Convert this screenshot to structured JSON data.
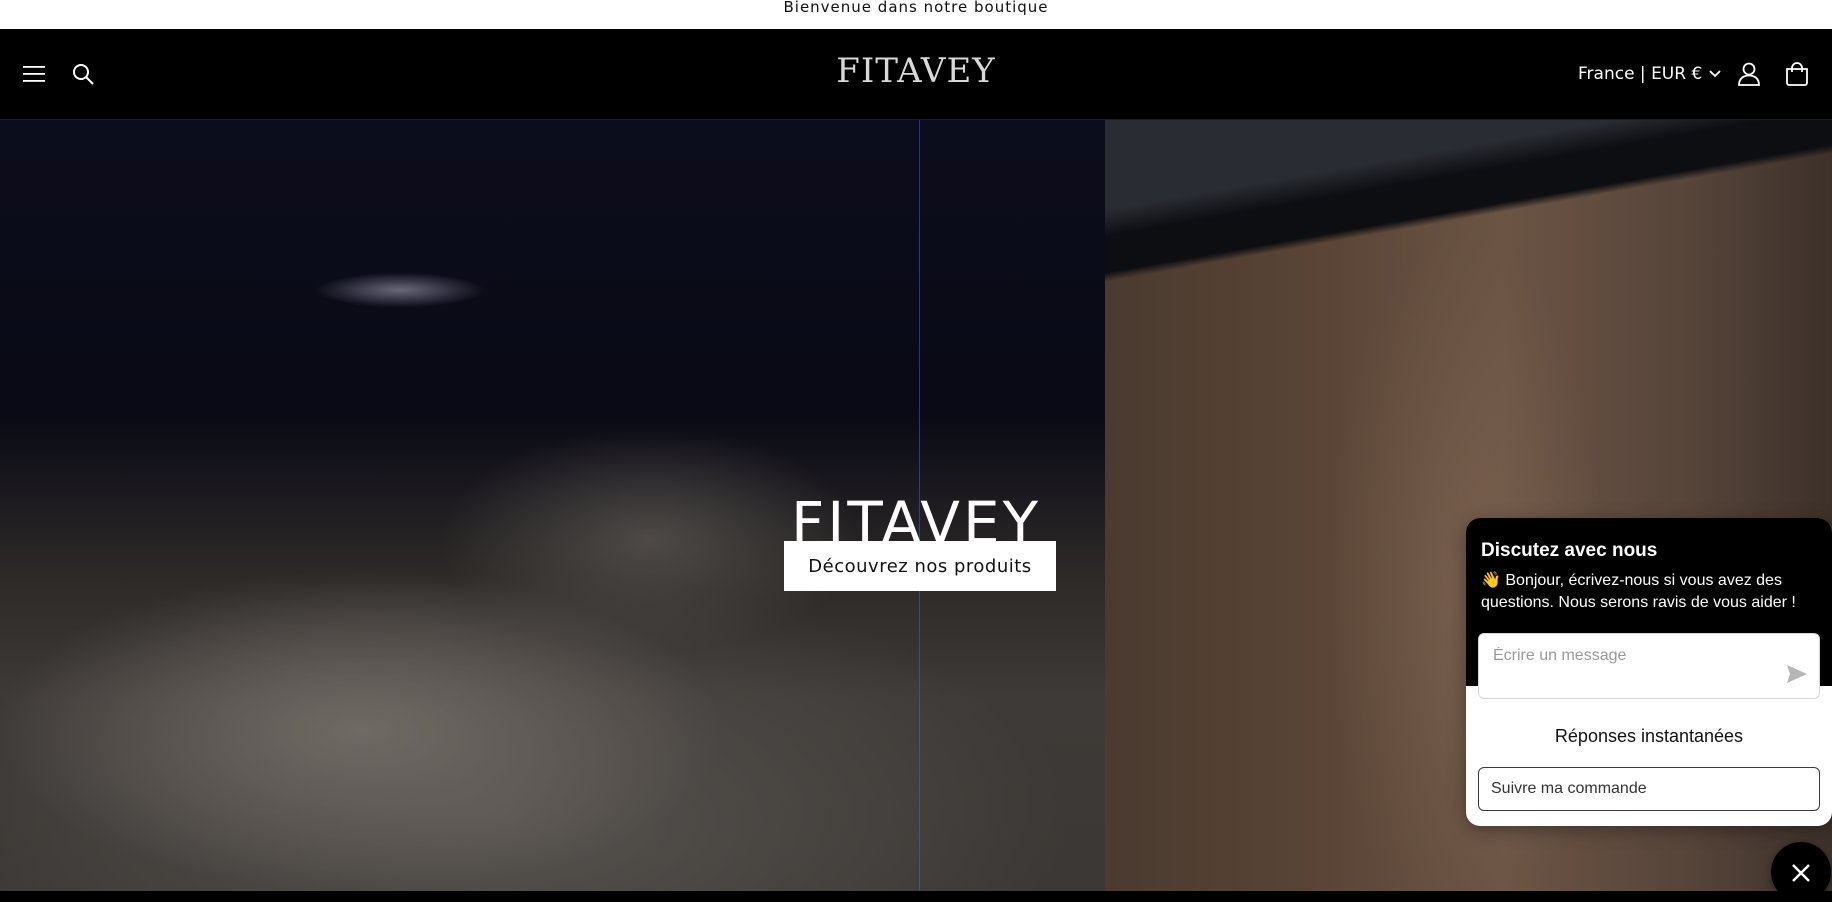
{
  "announcement": {
    "text": "Bienvenue dans notre boutique"
  },
  "header": {
    "logo": "FITAVEY",
    "locale": "France | EUR €",
    "icons": [
      "menu-icon",
      "search-icon",
      "chevron-down-icon",
      "account-icon",
      "cart-icon"
    ]
  },
  "hero": {
    "title": "FITAVEY",
    "cta_label": "Découvrez nos produits"
  },
  "chat": {
    "title": "Discutez avec nous",
    "greeting": "👋 Bonjour, écrivez-nous si vous avez des questions. Nous serons ravis de vous aider !",
    "input_placeholder": "Écrire un message",
    "quick_replies_title": "Réponses instantanées",
    "quick_replies": [
      "Suivre ma commande"
    ],
    "icons": [
      "send-icon",
      "close-icon"
    ]
  },
  "colors": {
    "header_bg": "#000000",
    "announcement_bg": "#ffffff",
    "cta_bg": "#ffffff",
    "chat_header_bg": "#000000"
  }
}
